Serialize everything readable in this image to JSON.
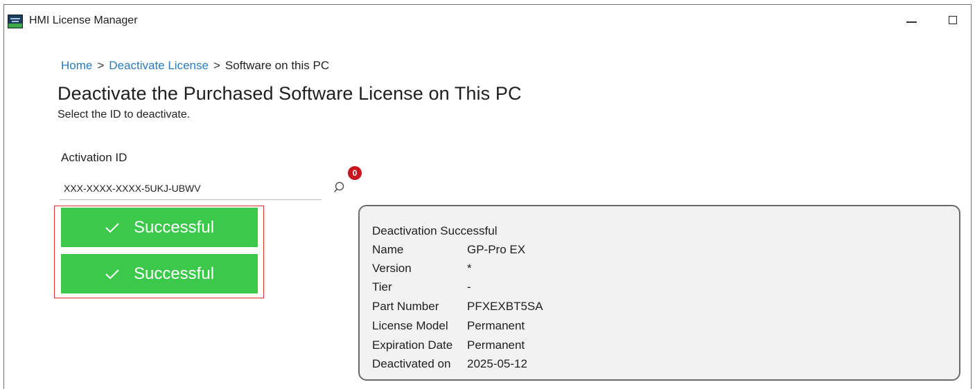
{
  "window": {
    "title": "HMI License Manager"
  },
  "breadcrumb": {
    "home": "Home",
    "separator": ">",
    "deactivate": "Deactivate License",
    "current": "Software on this PC"
  },
  "page": {
    "title": "Deactivate the Purchased Software License on This PC",
    "subtitle": "Select the ID to deactivate."
  },
  "activation": {
    "label": "Activation ID",
    "value": "XXX-XXXX-XXXX-5UKJ-UBWV",
    "badge_count": "0"
  },
  "status_buttons": [
    {
      "label": "Successful"
    },
    {
      "label": "Successful"
    }
  ],
  "details": {
    "heading": "Deactivation Successful",
    "rows": [
      {
        "key": "Name",
        "value": "GP-Pro EX"
      },
      {
        "key": "Version",
        "value": "*"
      },
      {
        "key": "Tier",
        "value": "-"
      },
      {
        "key": "Part Number",
        "value": "PFXEXBT5SA"
      },
      {
        "key": "License Model",
        "value": "Permanent"
      },
      {
        "key": "Expiration Date",
        "value": "Permanent"
      },
      {
        "key": "Deactivated on",
        "value": "2025-05-12"
      }
    ]
  },
  "icons": {
    "app": "app-logo-icon",
    "minimize": "minimize-icon",
    "maximize": "maximize-icon",
    "search": "search-icon",
    "check": "checkmark-icon"
  },
  "colors": {
    "link": "#2a7bc1",
    "success": "#3cc84b",
    "badge": "#c8141e",
    "highlight": "#d93030"
  }
}
